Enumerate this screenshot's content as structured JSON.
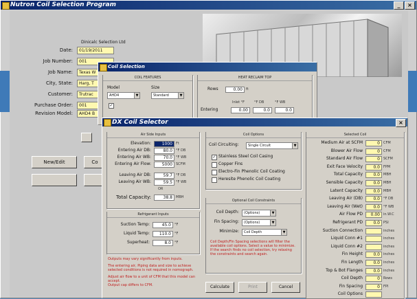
{
  "main": {
    "title": "Nutron Coil Selection Program",
    "header_text": "Dinicalc Selection Ltd",
    "fields": [
      {
        "label": "Date:",
        "value": "01/19/2011"
      },
      {
        "label": "Job Number:",
        "value": "001"
      },
      {
        "label": "Job Name:",
        "value": "Texas W"
      },
      {
        "label": "City, State:",
        "value": "Harg, T"
      },
      {
        "label": "Customer:",
        "value": "Trutrac"
      },
      {
        "label": "Purchase Order:",
        "value": "001"
      },
      {
        "label": "Revision Model:",
        "value": "AHD4 B"
      }
    ],
    "buttons": [
      "New/Edit",
      "Co"
    ]
  },
  "coil_dialog": {
    "title": "Coil Selection",
    "group_left": "COIL FEATURES",
    "group_right": "HEAT RECLAIM TOP",
    "model_label": "Model",
    "model_value": "AHD4",
    "size_label": "Size",
    "size_value": "Standard",
    "right_field_label": "Rows",
    "right_field_value": "0.00",
    "right_field_unit": "ft",
    "right_headers": [
      "Inlet °F",
      "°F DB",
      "°F WB"
    ],
    "right_row_label": "Entering",
    "right_row_values": [
      "0.00",
      "0.0",
      "0.0"
    ]
  },
  "dx": {
    "title": "DX Coil Selector",
    "air_group": "Air Side Inputs",
    "air_rows": [
      {
        "label": "Elevation:",
        "value": "1000",
        "unit": "Ft",
        "selected": true
      },
      {
        "label": "Entering Air DB:",
        "value": "80.0",
        "unit": "°F DB"
      },
      {
        "label": "Entering Air WB:",
        "value": "70.0",
        "unit": "°F WB"
      },
      {
        "label": "Entering Air Flow:",
        "value": "5000",
        "unit": "SCFM"
      }
    ],
    "leaving_rows": [
      {
        "label": "Leaving Air DB:",
        "value": "59.7",
        "unit": "°F DB"
      },
      {
        "label": "Leaving Air WB:",
        "value": "59.5",
        "unit": "°F WB"
      }
    ],
    "or_label": "OR",
    "total_label": "Total Capacity:",
    "total_value": "38.8",
    "total_unit": "MBH",
    "ref_group": "Refrigerant Inputs",
    "ref_rows": [
      {
        "label": "Suction Temp:",
        "value": "45.0",
        "unit": "°F"
      },
      {
        "label": "Liquid Temp:",
        "value": "110.0",
        "unit": "°F"
      },
      {
        "label": "Superheat:",
        "value": "8.0",
        "unit": "°F"
      }
    ],
    "red_notes": [
      "Outputs may vary significantly from inputs.",
      "The entering air, Piping data and size to achieve",
      "selected conditions is not required in nomograph.",
      "Adjust air flow to a unit of CFM that this model can",
      "accept.",
      "Output cap differs to CFM."
    ],
    "coil_group": "Coil Options",
    "circuiting_label": "Coil Circuiting:",
    "circuiting_value": "Single Circuit",
    "checkboxes": [
      {
        "label": "Stainless Steel Coil Casing",
        "checked": true
      },
      {
        "label": "Copper Fins",
        "checked": false
      },
      {
        "label": "Electro-Fin Phenolic Coil Coating",
        "checked": false
      },
      {
        "label": "Heresite Phenolic Coil Coating",
        "checked": false
      }
    ],
    "opt_group": "Optional Coil Constraints",
    "opt_rows": [
      {
        "label": "Coil Depth:",
        "value": "(Options)"
      },
      {
        "label": "Fin Spacing:",
        "value": "(Options)"
      },
      {
        "label": "Minimize:",
        "value": "Coil Depth"
      }
    ],
    "opt_note": "Coil Depth/Fin Spacing selections will filter the available coil options. Select a value to minimize. If the search finds no coil selection, try relaxing the constraints and search again.",
    "buttons": [
      "Calculate",
      "Print",
      "Cancel"
    ],
    "sel_group": "Selected Coil",
    "sel_rows": [
      {
        "label": "Medium Air at SCFM",
        "value": "0",
        "unit": "CFM"
      },
      {
        "label": "Blower Air Flow",
        "value": "0",
        "unit": "CFM"
      },
      {
        "label": "Standard Air Flow",
        "value": "0",
        "unit": "SCFM"
      },
      {
        "label": "Exit Face Velocity",
        "value": "0.0",
        "unit": "FPM"
      },
      {
        "label": "Total Capacity",
        "value": "0.0",
        "unit": "MBH"
      },
      {
        "label": "Sensible Capacity",
        "value": "0.0",
        "unit": "MBH"
      },
      {
        "label": "Latent Capacity",
        "value": "0.0",
        "unit": "MBH"
      },
      {
        "label": "Leaving Air (DB)",
        "value": "0.0",
        "unit": "°F DB"
      },
      {
        "label": "Leaving Air (Wet)",
        "value": "0.0",
        "unit": "°F WB"
      },
      {
        "label": "Air Flow PD",
        "value": "0.00",
        "unit": "in.W.C"
      },
      {
        "label": "Refrigerant PD",
        "value": "0.0",
        "unit": "PSI"
      },
      {
        "label": "Suction Connection",
        "value": "",
        "unit": "inches"
      },
      {
        "label": "Liquid Conn #1",
        "value": "",
        "unit": "inches"
      },
      {
        "label": "Liquid Conn #2",
        "value": "",
        "unit": "inches"
      },
      {
        "label": "Fin Height",
        "value": "0.0",
        "unit": "inches"
      },
      {
        "label": "Fin Length",
        "value": "0.0",
        "unit": "inches"
      },
      {
        "label": "Top & Bot Flanges",
        "value": "0.0",
        "unit": "inches"
      },
      {
        "label": "Coil Depth",
        "value": "0",
        "unit": "Rows"
      },
      {
        "label": "Fin Spacing",
        "value": "0",
        "unit": "FPI"
      },
      {
        "label": "Coil Options",
        "value": "",
        "unit": ""
      }
    ]
  },
  "colors": {
    "titlebar": "#0a246a",
    "field_yellow": "#fff8b0",
    "note_red": "#c02020",
    "desktop_blue": "#5f8fc0"
  }
}
